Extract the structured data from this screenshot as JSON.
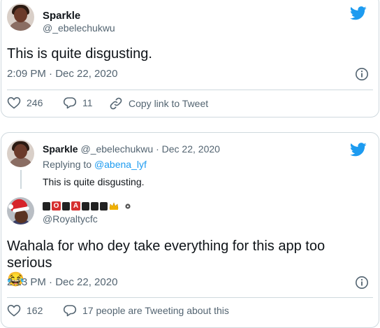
{
  "tweet1": {
    "name": "Sparkle",
    "handle": "@_ebelechukwu",
    "text": "This is quite disgusting.",
    "meta": "2:09 PM · Dec 22, 2020",
    "likes": "246",
    "replies": "11",
    "copy_link": "Copy link to Tweet"
  },
  "tweet2": {
    "quoted": {
      "name": "Sparkle",
      "handle_date": "@_ebelechukwu · Dec 22, 2020",
      "replying_prefix": "Replying to ",
      "replying_to": "@abena_lyf",
      "text": "This is quite disgusting."
    },
    "author_handle": "@Royaltycfc",
    "author_name_blocks": [
      "O",
      "A"
    ],
    "text": "Wahala for who dey take everything for this app too serious",
    "emoji": "😂",
    "meta": "2:13 PM · Dec 22, 2020",
    "likes": "162",
    "tweeting_about": "17 people are Tweeting about this"
  },
  "colors": {
    "twitter_blue": "#1d9bf0",
    "text": "#0f1419",
    "muted": "#536471",
    "border": "#cfd9de"
  }
}
